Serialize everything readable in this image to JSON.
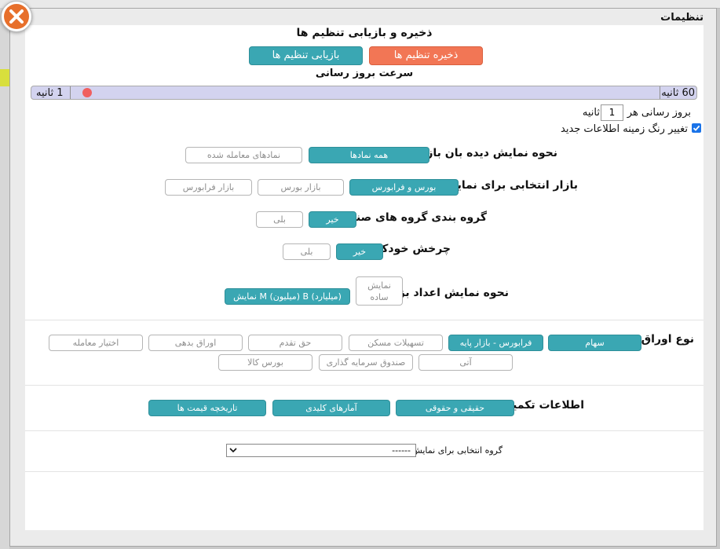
{
  "dialog": {
    "title": "تنظیمات",
    "close_icon": "close-x-icon",
    "accent_orange": "#f27655",
    "accent_teal": "#3aa7b3"
  },
  "save_section": {
    "heading": "ذخیره و بازیابی تنظیم ها",
    "save_label": "ذخیره تنظیم ها",
    "restore_label": "بازیابی تنظیم ها"
  },
  "refresh": {
    "heading": "سرعت بروز رسانی",
    "max_label": "60 ثانیه",
    "min_label": "1 ثانیه",
    "slider_value_seconds": 1,
    "every_label": "بروز رسانی هر",
    "interval_value": "1",
    "seconds_label": "ثانیه",
    "bg_change_label": "تغییر رنگ زمینه اطلاعات جدید",
    "bg_change_checked": true
  },
  "watch_mode": {
    "label": "نحوه نمایش دیده بان بازار؟",
    "options": [
      "همه نمادها",
      "نمادهای معامله شده"
    ],
    "selected": "همه نمادها"
  },
  "market": {
    "label": "بازار انتخابی برای نمایش",
    "options": [
      "بورس و فرابورس",
      "بازار بورس",
      "بازار فرابورس"
    ],
    "selected": "بورس و فرابورس"
  },
  "industry_group": {
    "label": "گروه بندی گروه های صنعت",
    "options": [
      "خیر",
      "بلی"
    ],
    "selected": "خیر"
  },
  "auto_rotate": {
    "label": "چرخش خودکار",
    "options": [
      "خیر",
      "بلی"
    ],
    "selected": "خیر"
  },
  "big_numbers": {
    "label": "نحوه نمایش اعداد بزرگ",
    "simple_line1": "نمایش",
    "simple_line2": "ساده",
    "mb_label": "نمایش M (میلیون) B (میلیارد)",
    "selected": "mb"
  },
  "securities": {
    "label": "نوع اوراق",
    "row1": [
      "سهام",
      "فرابورس - بازار پایه",
      "تسهیلات مسکن",
      "حق تقدم",
      "اوراق بدهی",
      "اختیار معامله"
    ],
    "row1_selected": [
      true,
      true,
      false,
      false,
      false,
      false
    ],
    "row2": [
      "آتی",
      "صندوق سرمایه گذاری",
      "بورس کالا"
    ],
    "row2_selected": [
      false,
      false,
      false
    ]
  },
  "extra": {
    "label": "اطلاعات تکمیلی",
    "buttons": [
      "حقیقی و حقوقی",
      "آمارهای کلیدی",
      "تاریخچه قیمت ها"
    ]
  },
  "group_select": {
    "label": "گروه انتخابی برای نمایش",
    "value": "------"
  }
}
